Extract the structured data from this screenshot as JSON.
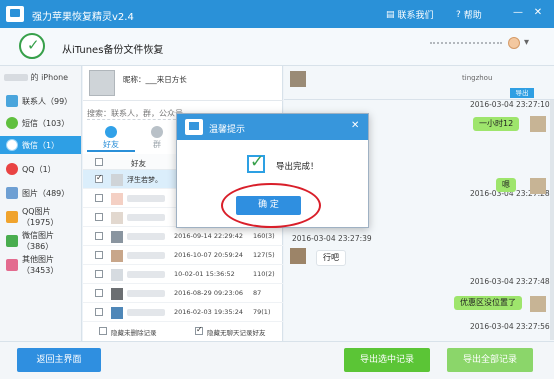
{
  "window": {
    "title": "强力苹果恢复精灵v2.4",
    "contact_us": "联系我们",
    "help": "帮助"
  },
  "header": {
    "heading": "从iTunes备份文件恢复"
  },
  "sidebar": {
    "device_label": "的 iPhone",
    "items": [
      {
        "label": "联系人（99）",
        "icon": "contacts-icon",
        "color": "#4aa5dc"
      },
      {
        "label": "短信（103）",
        "icon": "message-icon",
        "color": "#60c03f"
      },
      {
        "label": "微信（1）",
        "icon": "wechat-icon",
        "color": "#ffffff"
      },
      {
        "label": "QQ（1）",
        "icon": "qq-icon",
        "color": "#e94343"
      },
      {
        "label": "图片（489）",
        "icon": "photo-icon",
        "color": "#6e9fd3"
      },
      {
        "label": "QQ图片（1975）",
        "icon": "qq-photo-icon",
        "color": "#f0a32d"
      },
      {
        "label": "微信图片（386）",
        "icon": "wechat-photo-icon",
        "color": "#49ad4f"
      },
      {
        "label": "其他图片（3453）",
        "icon": "other-photo-icon",
        "color": "#e36b8f"
      }
    ]
  },
  "middle": {
    "nickname": "昵称：___来日方长",
    "search_label": "搜索：联系人，群，公众号",
    "tabs": [
      {
        "label": "好友"
      },
      {
        "label": "群"
      }
    ],
    "header_label": "好友",
    "rows": [
      {
        "name": "浮生若梦。",
        "date": "",
        "count": ""
      },
      {
        "name": "",
        "date": "",
        "count": ""
      },
      {
        "name": "",
        "date": "",
        "count": ""
      },
      {
        "name": "",
        "date": "2016-09-14 22:29:42",
        "count": "160(3)"
      },
      {
        "name": "",
        "date": "2016-10-07 20:59:24",
        "count": "127(5)"
      },
      {
        "name": "",
        "date": "10-02-01 15:36:52",
        "count": "110(2)"
      },
      {
        "name": "",
        "date": "2016-08-29 09:23:06",
        "count": "87"
      },
      {
        "name": "",
        "date": "2016-02-03 19:35:24",
        "count": "79(1)"
      }
    ],
    "filter_deleted": "隐藏未删除记录",
    "filter_empty": "隐藏无聊天记录好友"
  },
  "chat": {
    "contact_line": "tingzhou",
    "export_label": "导出",
    "messages": [
      {
        "time": "2016-03-04 23:27:10",
        "text": "一小时12",
        "side": "out"
      },
      {
        "time": "2016-03-04 23:27:28",
        "text": "嗯",
        "side": "out"
      },
      {
        "time": "2016-03-04 23:27:39",
        "text": "行吧",
        "side": "in"
      },
      {
        "time": "2016-03-04 23:27:48",
        "text": "优惠区没位置了",
        "side": "out"
      },
      {
        "time": "2016-03-04 23:27:56",
        "text": "",
        "side": "out"
      }
    ]
  },
  "footer": {
    "back_label": "返回主界面",
    "export_selected_label": "导出选中记录",
    "export_all_label": "导出全部记录"
  },
  "dialog": {
    "title": "温馨提示",
    "message": "导出完成！",
    "ok_label": "确 定"
  }
}
